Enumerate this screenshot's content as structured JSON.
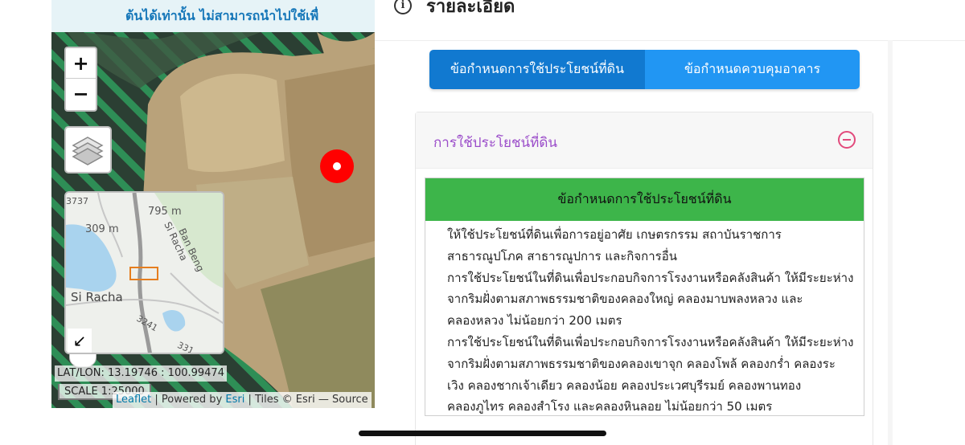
{
  "map": {
    "banner_text": "ต้นได้เท่านั้น ไม่สามารถนำไปใช้เพื่",
    "zoom_in": "+",
    "zoom_out": "−",
    "minimap": {
      "labels": [
        "3737",
        "795 m",
        "309 m",
        "Ban Beng",
        "Si Racha",
        "Si Racha",
        "3241",
        "331"
      ],
      "toggle_glyph": "↙"
    },
    "coords_text": "LAT/LON: 13.19746 : 100.99474",
    "scale_text": "SCALE 1:25000",
    "attribution": {
      "leaflet": "Leaflet",
      "sep1": " | Powered by ",
      "esri": "Esri",
      "rest": " | Tiles © Esri — Source"
    },
    "colors": {
      "stripe": "#2fa861",
      "marker": "#ff0000"
    }
  },
  "panel": {
    "title": "รายละเอียด",
    "info_icon": "i",
    "tabs": [
      {
        "label": "ข้อกำหนดการใช้ประโยชน์ที่ดิน",
        "active": true
      },
      {
        "label": "ข้อกำหนดควบคุมอาคาร",
        "active": false
      }
    ],
    "section_title": "การใช้ประโยชน์ที่ดิน",
    "table_header": "ข้อกำหนดการใช้ประโยชน์ที่ดิน",
    "lines": [
      "ให้ใช้ประโยชน์ที่ดินเพื่อการอยู่อาศัย เกษตรกรรม สถาบันราชการ",
      "สาธารณูปโภค สาธารณูปการ และกิจการอื่น",
      "การใช้ประโยชน์ในที่ดินเพื่อประกอบกิจการโรงงานหรือคลังสินค้า ให้มีระยะห่าง",
      "จากริมฝั่งตามสภาพธรรมชาติของคลองใหญ่ คลองมาบพลงหลวง และ",
      "คลองหลวง ไม่น้อยกว่า 200 เมตร",
      "การใช้ประโยชน์ในที่ดินเพื่อประกอบกิจการโรงงานหรือคลังสินค้า ให้มีระยะห่าง",
      "จากริมฝั่งตามสภาพธรรมชาติของคลองเขาจุก คลองโพล้ คลองกร่ำ คลองระ",
      "เวิง คลองชากเจ้าเดียว คลองน้อย คลองประเวศบุรีรมย์ คลองพานทอง",
      "คลองภูไทร คลองสำโรง และคลองหินลอย ไม่น้อยกว่า 50 เมตร"
    ],
    "colors": {
      "tab_active": "#1179d0",
      "tab_inactive": "#2196f3",
      "table_header": "#3db54a",
      "section_title": "#9b4dca"
    }
  }
}
